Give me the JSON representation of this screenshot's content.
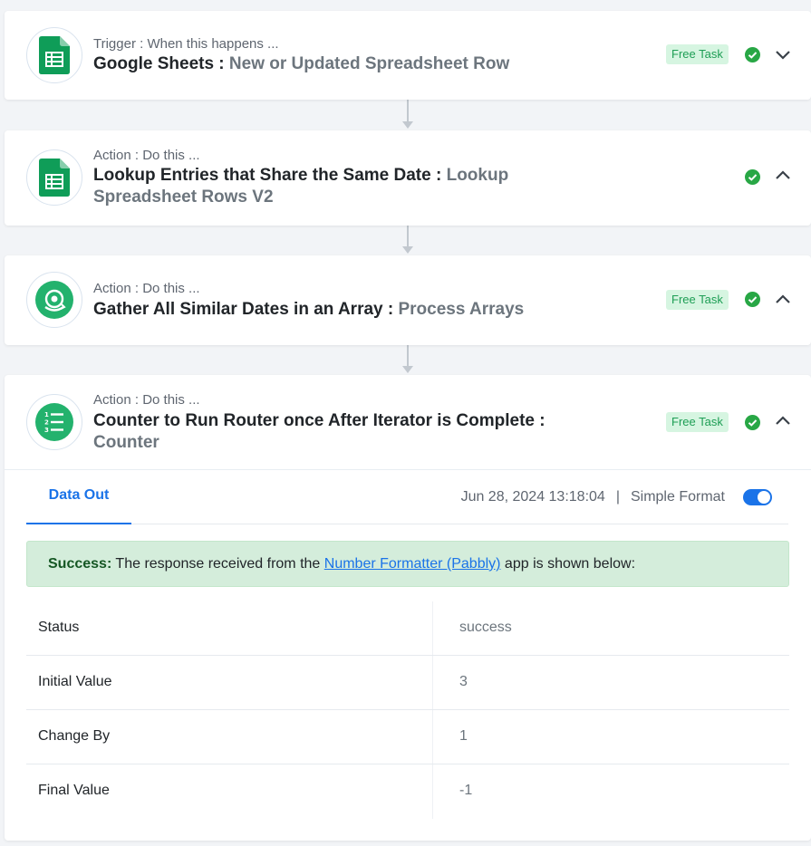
{
  "colors": {
    "sheets_green": "#0f9d58",
    "process_green": "#23b26d",
    "success_green": "#28a745",
    "accent_blue": "#1a73e8",
    "badge_bg": "#d6f5e1",
    "alert_bg": "#d4eddb"
  },
  "steps": [
    {
      "type": "Trigger : When this happens ...",
      "title": "Google Sheets : ",
      "app_action": "New or Updated Spreadsheet Row",
      "badge": "Free Task",
      "icon": "google-sheets-icon",
      "chevron": "chevron-down-icon"
    },
    {
      "type": "Action : Do this ...",
      "title": "Lookup Entries that Share the Same Date : ",
      "app_action": "Lookup Spreadsheet Rows V2",
      "icon": "google-sheets-icon",
      "chevron": "chevron-up-icon"
    },
    {
      "type": "Action : Do this ...",
      "title": "Gather All Similar Dates in an Array : ",
      "app_action": "Process Arrays",
      "badge": "Free Task",
      "icon": "process-arrays-icon",
      "chevron": "chevron-up-icon"
    },
    {
      "type": "Action : Do this ...",
      "title": "Counter to Run Router once After Iterator is Complete : ",
      "app_action": "Counter",
      "badge": "Free Task",
      "icon": "number-list-icon",
      "chevron": "chevron-up-icon"
    }
  ],
  "detail": {
    "tab_label": "Data Out",
    "timestamp": "Jun 28, 2024 13:18:04",
    "separator": "|",
    "format_label": "Simple Format",
    "format_enabled": true,
    "alert": {
      "strong": "Success:",
      "before_link": " The response received from the ",
      "link_text": "Number Formatter (Pabbly)",
      "after_link": " app is shown below:"
    },
    "rows": [
      {
        "key": "Status",
        "value": "success"
      },
      {
        "key": "Initial Value",
        "value": "3"
      },
      {
        "key": "Change By",
        "value": "1"
      },
      {
        "key": "Final Value",
        "value": "-1"
      }
    ]
  }
}
